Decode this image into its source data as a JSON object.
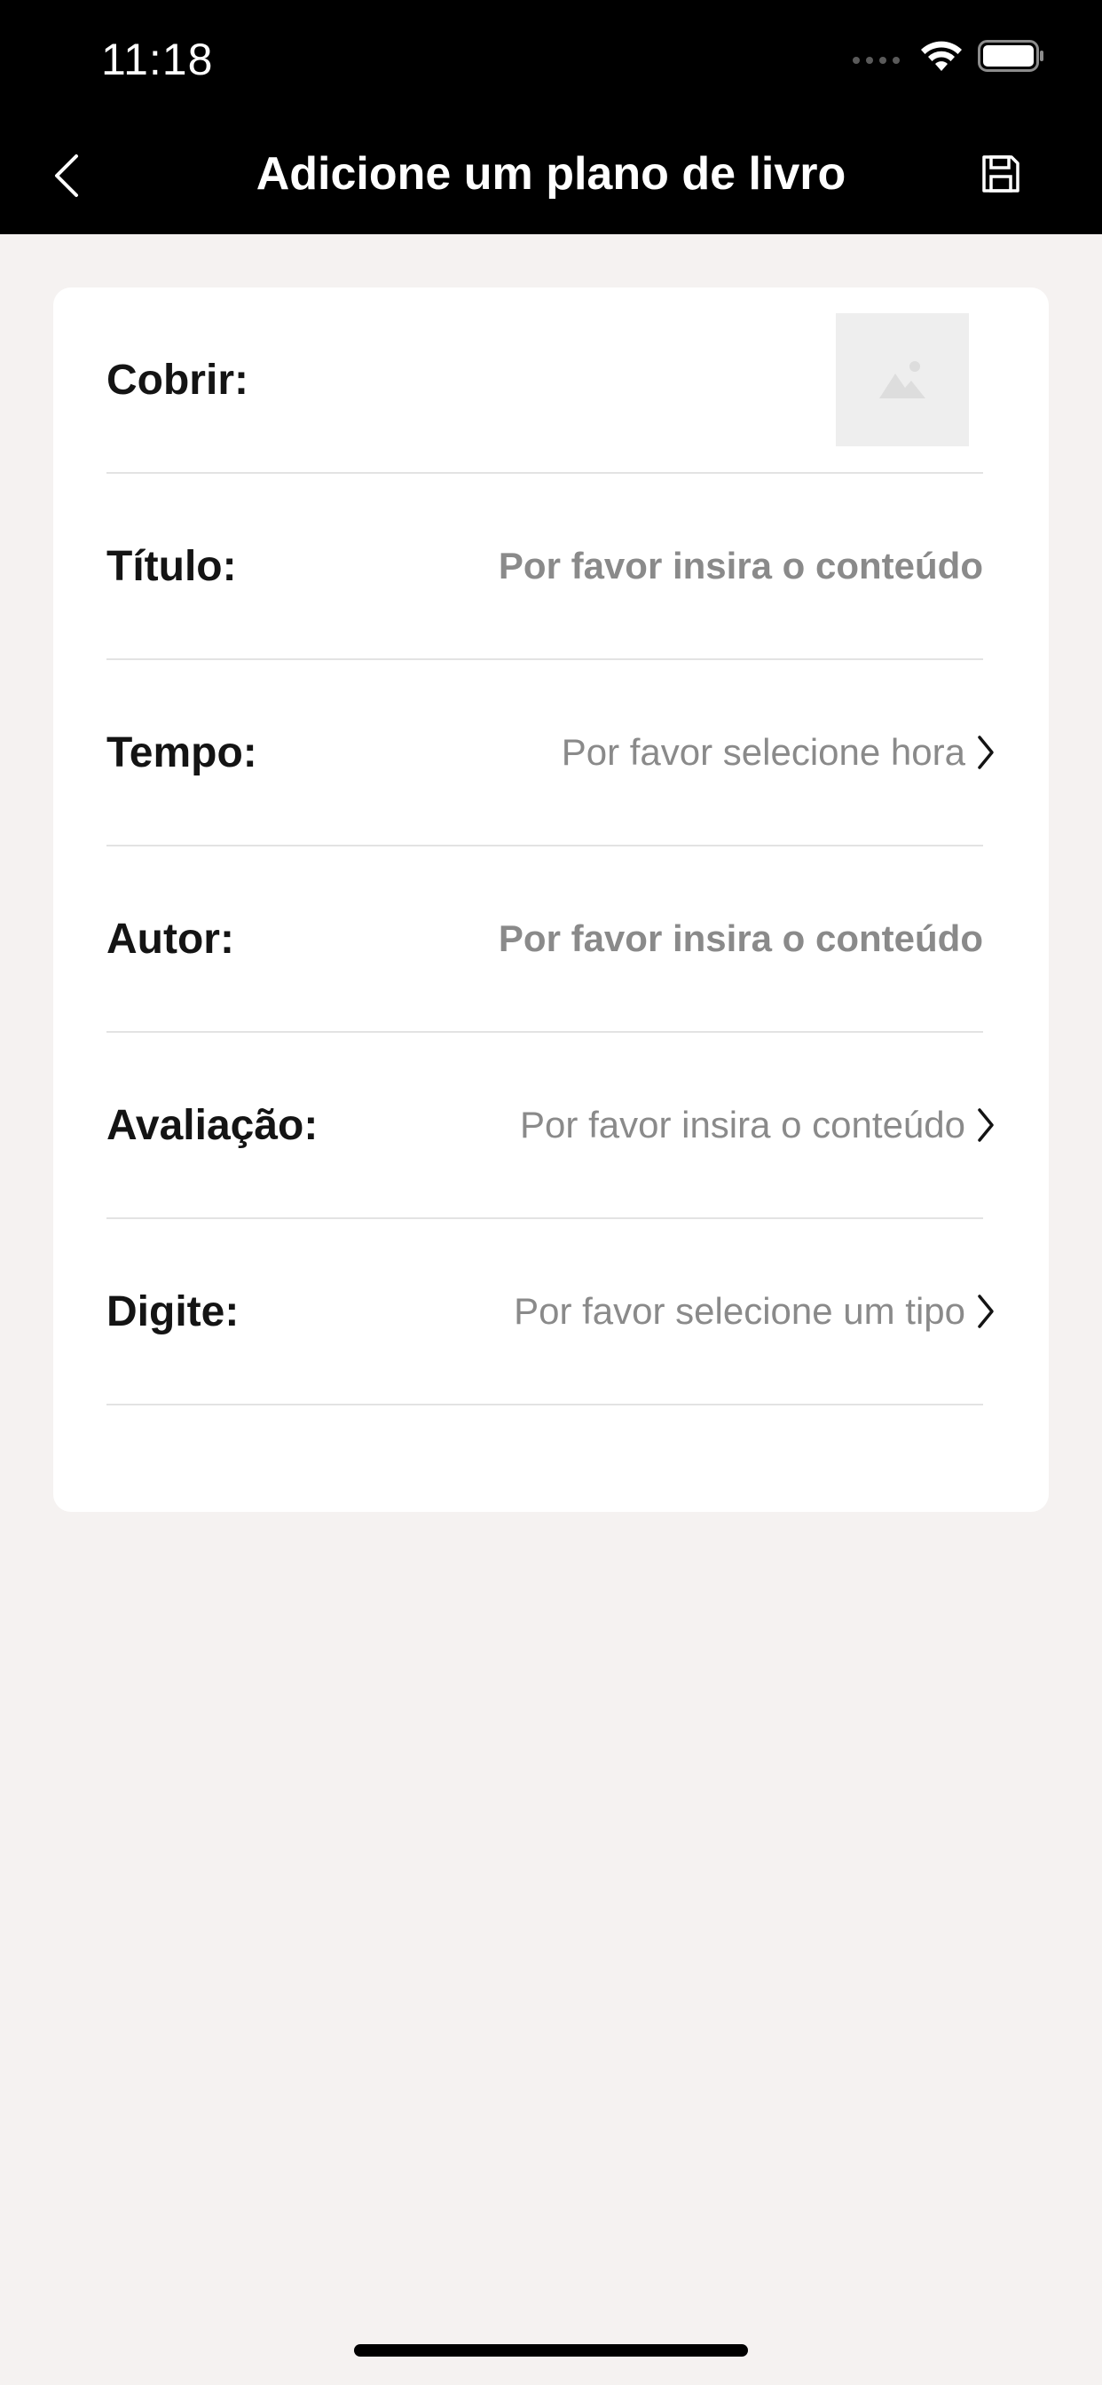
{
  "status_bar": {
    "time": "11:18",
    "icons": [
      "signal-dots-icon",
      "wifi-icon",
      "battery-icon"
    ]
  },
  "nav": {
    "title": "Adicione um plano de livro",
    "back_icon": "chevron-left-icon",
    "save_icon": "floppy-disk-icon"
  },
  "form": {
    "cover": {
      "label": "Cobrir:",
      "icon": "image-placeholder-icon"
    },
    "title": {
      "label": "Título:",
      "placeholder": "Por favor insira o conteúdo"
    },
    "time": {
      "label": "Tempo:",
      "value": "Por favor selecione hora"
    },
    "author": {
      "label": "Autor:",
      "placeholder": "Por favor insira o conteúdo"
    },
    "rating": {
      "label": "Avaliação:",
      "value": "Por favor insira o conteúdo"
    },
    "type": {
      "label": "Digite:",
      "value": "Por favor selecione um tipo"
    }
  },
  "colors": {
    "header_bg": "#000000",
    "page_bg": "#f5f2f1",
    "card_bg": "#ffffff",
    "placeholder_text": "#8a8a8a"
  }
}
